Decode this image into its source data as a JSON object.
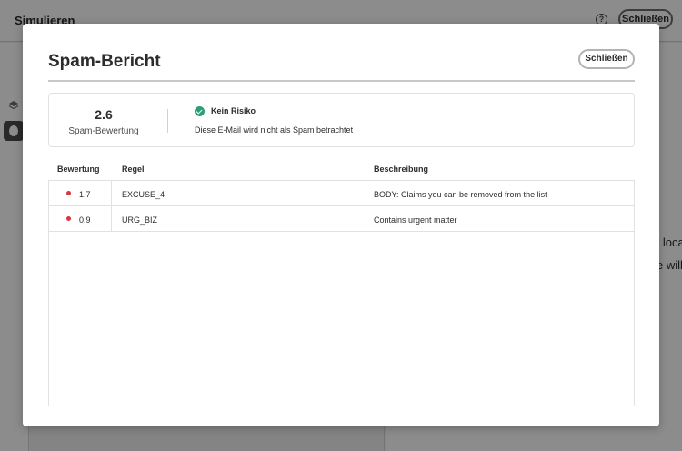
{
  "app": {
    "title": "Simulieren",
    "close_label": "Schließen"
  },
  "background_text": {
    "line1": "n loca",
    "line2": "e will"
  },
  "dialog": {
    "title": "Spam-Bericht",
    "close_label": "Schließen"
  },
  "score": {
    "value": "2.6",
    "label": "Spam-Bewertung",
    "risk_title": "Kein Risiko",
    "risk_description": "Diese E-Mail wird nicht als Spam betrachtet",
    "risk_color": "#2d9d78"
  },
  "table": {
    "headers": {
      "rating": "Bewertung",
      "rule": "Regel",
      "description": "Beschreibung"
    },
    "rows": [
      {
        "rating": "1.7",
        "rule": "EXCUSE_4",
        "description": "BODY: Claims you can be removed from the list",
        "status_color": "#d7373f"
      },
      {
        "rating": "0.9",
        "rule": "URG_BIZ",
        "description": "Contains urgent matter",
        "status_color": "#d7373f"
      }
    ]
  }
}
